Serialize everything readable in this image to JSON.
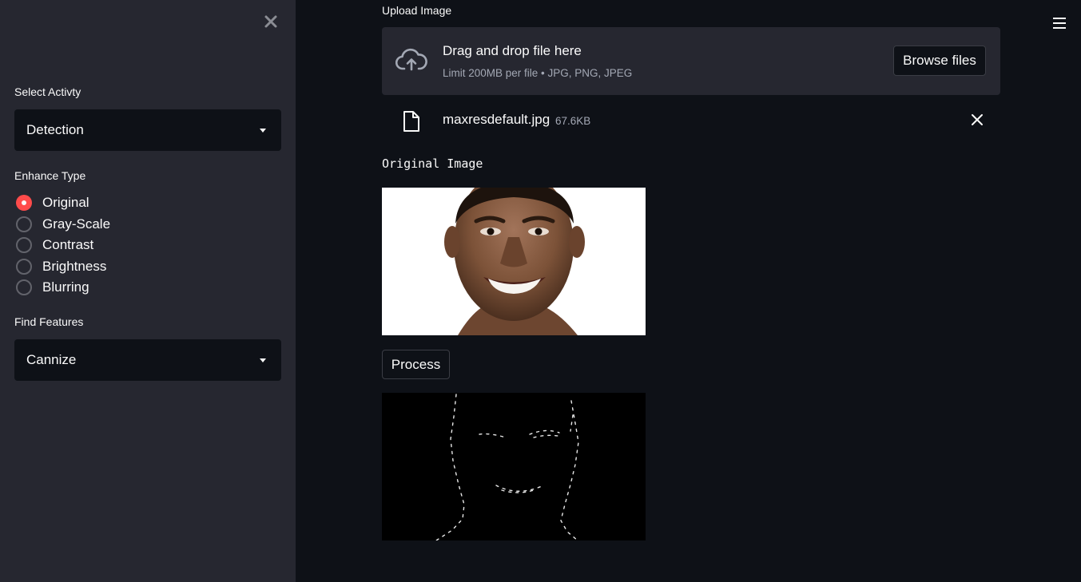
{
  "sidebar": {
    "select_activity_label": "Select Activty",
    "select_activity_value": "Detection",
    "enhance_type_label": "Enhance Type",
    "enhance_options": [
      "Original",
      "Gray-Scale",
      "Contrast",
      "Brightness",
      "Blurring"
    ],
    "enhance_selected": "Original",
    "find_features_label": "Find Features",
    "find_features_value": "Cannize"
  },
  "uploader": {
    "label": "Upload Image",
    "dropzone_title": "Drag and drop file here",
    "dropzone_limit": "Limit 200MB per file • JPG, PNG, JPEG",
    "browse_label": "Browse files",
    "file_name": "maxresdefault.jpg",
    "file_size": "67.6KB"
  },
  "main": {
    "original_caption": "Original Image",
    "process_label": "Process"
  },
  "colors": {
    "accent": "#ff4b4b",
    "background": "#0e1117",
    "sidebar": "#262730"
  },
  "icons": {
    "sidebar_close": "close-icon",
    "menu": "hamburger-menu-icon",
    "upload": "cloud-upload-icon",
    "file": "file-icon",
    "remove": "close-icon"
  }
}
